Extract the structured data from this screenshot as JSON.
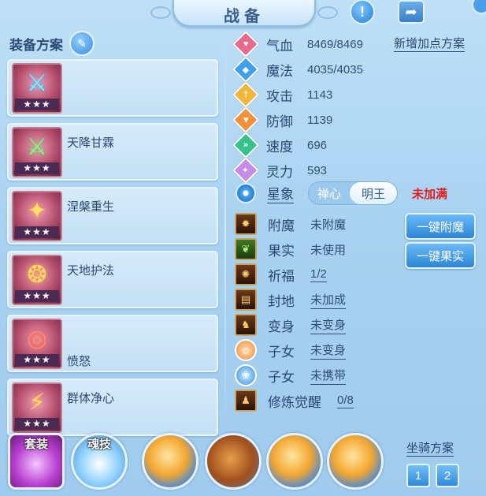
{
  "title": "战备",
  "header": {
    "info_icon": "exclamation-icon",
    "share_icon": "share-icon"
  },
  "plans_header": {
    "label": "装备方案",
    "edit_icon": "pencil-icon"
  },
  "plans": [
    {
      "name": "",
      "sub": "",
      "stars": "★★★"
    },
    {
      "name": "天降甘霖",
      "sub": "",
      "stars": "★★★"
    },
    {
      "name": "涅槃重生",
      "sub": "",
      "stars": "★★★"
    },
    {
      "name": "天地护法",
      "sub": "",
      "stars": "★★★"
    },
    {
      "name": "",
      "sub": "愤怒",
      "stars": "★★★"
    },
    {
      "name": "群体净心",
      "sub": "",
      "stars": "★★★"
    }
  ],
  "add_plan_label": "新增加点方案",
  "stats": [
    {
      "label": "气血",
      "value": "8469/8469",
      "color": "#e96b8b",
      "glyph": "♥"
    },
    {
      "label": "魔法",
      "value": "4035/4035",
      "color": "#3f9ff0",
      "glyph": "◆"
    },
    {
      "label": "攻击",
      "value": "1143",
      "color": "#f2b63a",
      "glyph": "†"
    },
    {
      "label": "防御",
      "value": "1139",
      "color": "#f2913a",
      "glyph": "▼"
    },
    {
      "label": "速度",
      "value": "696",
      "color": "#37c28a",
      "glyph": "»"
    },
    {
      "label": "灵力",
      "value": "593",
      "color": "#c58be6",
      "glyph": "✦"
    }
  ],
  "star_sign": {
    "label": "星象",
    "options": [
      "禅心",
      "明王"
    ],
    "selected": "明王",
    "status": "未加满"
  },
  "buffs": [
    {
      "label": "附魔",
      "value": "未附魔",
      "underline": false,
      "kind": "enchant"
    },
    {
      "label": "果实",
      "value": "未使用",
      "underline": false,
      "kind": "fruit"
    },
    {
      "label": "祈福",
      "value": "1/2",
      "underline": true,
      "kind": "bless"
    },
    {
      "label": "封地",
      "value": "未加成",
      "underline": true,
      "kind": "fief"
    },
    {
      "label": "变身",
      "value": "未变身",
      "underline": true,
      "kind": "transform"
    },
    {
      "label": "子女",
      "value": "未变身",
      "underline": true,
      "kind": "child"
    },
    {
      "label": "子女",
      "value": "未携带",
      "underline": true,
      "kind": "pet"
    },
    {
      "label": "修炼觉醒",
      "value": "0/8",
      "underline": true,
      "kind": "cultivate"
    }
  ],
  "buttons": {
    "one_click_enchant": "一键附魔",
    "one_click_fruit": "一键果实"
  },
  "bottom": {
    "suit_label": "套装",
    "soul_label": "魂技",
    "mount_label": "坐骑方案",
    "mount_options": [
      "1",
      "2"
    ]
  }
}
